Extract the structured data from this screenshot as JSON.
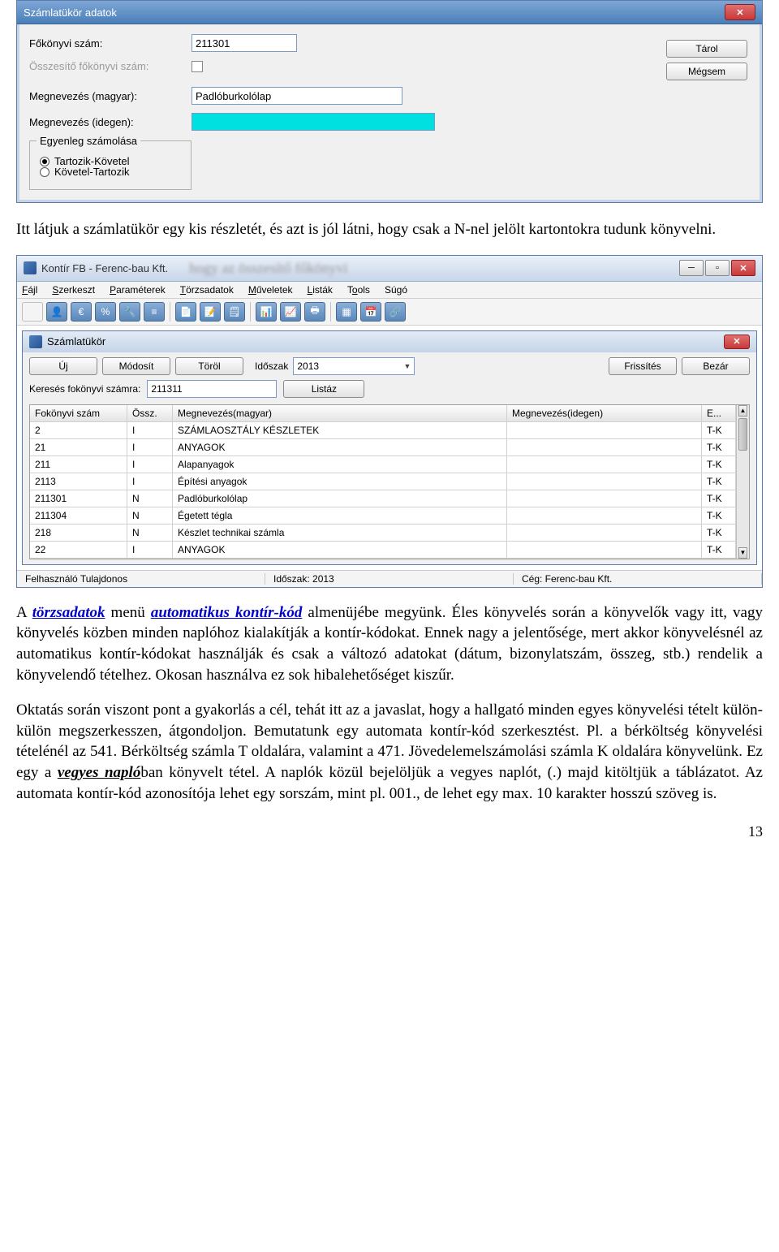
{
  "dialog1": {
    "title": "Számlatükör adatok",
    "labels": {
      "fokonyvi": "Főkönyvi szám:",
      "osszesito": "Összesítő főkönyvi szám:",
      "megnev_hu": "Megnevezés (magyar):",
      "megnev_idegen": "Megnevezés (idegen):"
    },
    "values": {
      "fokonyvi": "211301",
      "megnev_hu": "Padlóburkolólap",
      "megnev_idegen": ""
    },
    "fieldset": {
      "legend": "Egyenleg számolása",
      "opt1": "Tartozik-Követel",
      "opt2": "Követel-Tartozik"
    },
    "buttons": {
      "store": "Tárol",
      "cancel": "Mégsem"
    }
  },
  "para1": "Itt látjuk a számlatükör egy kis részletét, és azt is jól látni, hogy csak a N-nel jelölt kartontokra tudunk könyvelni.",
  "appwin": {
    "title": "Kontír FB  - Ferenc-bau Kft.",
    "blur": "hogy az összesítő főkönyvi",
    "menu": [
      "Fájl",
      "Szerkeszt",
      "Paraméterek",
      "Törzsadatok",
      "Műveletek",
      "Listák",
      "Tools",
      "Súgó"
    ],
    "child_title": "Számlatükör",
    "btns": {
      "new": "Új",
      "modify": "Módosít",
      "delete": "Töröl",
      "period": "Időszak",
      "refresh": "Frissítés",
      "close": "Bezár",
      "list": "Listáz"
    },
    "period_value": "2013",
    "search_label": "Keresés fokönyvi számra:",
    "search_value": "211311",
    "columns": [
      "Fokönyvi szám",
      "Össz.",
      "Megnevezés(magyar)",
      "Megnevezés(idegen)",
      "E..."
    ],
    "rows": [
      {
        "c1": "2",
        "c2": "I",
        "c3": "SZÁMLAOSZTÁLY KÉSZLETEK",
        "c4": "",
        "c5": "T-K"
      },
      {
        "c1": "21",
        "c2": "I",
        "c3": "ANYAGOK",
        "c4": "",
        "c5": "T-K"
      },
      {
        "c1": "211",
        "c2": "I",
        "c3": "Alapanyagok",
        "c4": "",
        "c5": "T-K"
      },
      {
        "c1": "2113",
        "c2": "I",
        "c3": "Építési anyagok",
        "c4": "",
        "c5": "T-K"
      },
      {
        "c1": "211301",
        "c2": "N",
        "c3": "Padlóburkolólap",
        "c4": "",
        "c5": "T-K"
      },
      {
        "c1": "211304",
        "c2": "N",
        "c3": "Égetett tégla",
        "c4": "",
        "c5": "T-K"
      },
      {
        "c1": "218",
        "c2": "N",
        "c3": "Készlet technikai számla",
        "c4": "",
        "c5": "T-K"
      },
      {
        "c1": "22",
        "c2": "I",
        "c3": "ANYAGOK",
        "c4": "",
        "c5": "T-K"
      }
    ],
    "status": {
      "user": "Felhasználó Tulajdonos",
      "period": "Időszak: 2013",
      "company": "Cég: Ferenc-bau Kft."
    }
  },
  "para2a": "A ",
  "para2_link1": "törzsadatok",
  "para2b": " menü ",
  "para2_link2": "automatikus kontír-kód",
  "para2c": " almenüjébe megyünk. Éles könyvelés során a könyvelők vagy itt, vagy könyvelés közben minden naplóhoz kialakítják a kontír-kódokat. Ennek nagy a jelentősége, mert akkor könyvelésnél az automatikus kontír-kódokat használják és csak a változó adatokat (dátum, bizonylatszám, összeg, stb.) rendelik a könyvelendő tételhez. Okosan használva ez sok hibalehetőséget kiszűr.",
  "para3a": "Oktatás során viszont pont a gyakorlás a cél, tehát itt az a javaslat, hogy a hallgató minden egyes könyvelési tételt külön-külön megszerkesszen, átgondoljon. Bemutatunk egy automata kontír-kód szerkesztést. Pl. a bérköltség könyvelési tételénél az 541. Bérköltség számla T oldalára, valamint a 471. Jövedelemelszámolási számla K oldalára könyvelünk. Ez egy a ",
  "para3_emph": "vegyes napló",
  "para3b": "ban könyvelt tétel. A naplók közül bejelöljük a vegyes naplót, (.) majd kitöltjük a táblázatot. Az automata kontír-kód azonosítója lehet egy sorszám, mint pl. 001., de lehet egy max. 10 karakter hosszú szöveg is.",
  "page_number": "13"
}
